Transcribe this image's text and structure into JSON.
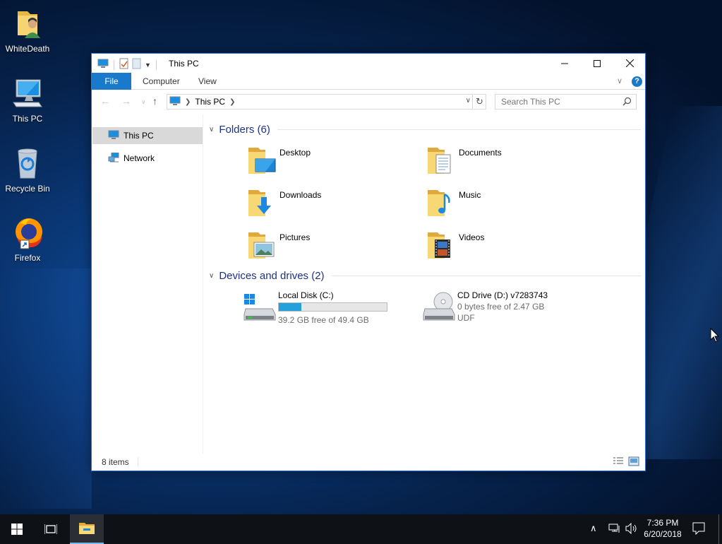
{
  "desktop": {
    "icons": [
      {
        "label": "WhiteDeath",
        "icon": "user-folder-icon"
      },
      {
        "label": "This PC",
        "icon": "computer-icon"
      },
      {
        "label": "Recycle Bin",
        "icon": "recycle-bin-icon"
      },
      {
        "label": "Firefox",
        "icon": "firefox-icon"
      }
    ]
  },
  "window": {
    "title": "This PC",
    "ribbon": {
      "tabs": [
        "File",
        "Computer",
        "View"
      ],
      "help": "?"
    },
    "address": {
      "crumb": "This PC"
    },
    "search": {
      "placeholder": "Search This PC"
    },
    "nav_pane": [
      {
        "label": "This PC",
        "selected": true,
        "icon": "computer-icon"
      },
      {
        "label": "Network",
        "selected": false,
        "icon": "network-icon"
      }
    ],
    "folders_group": {
      "header": "Folders (6)",
      "items": [
        {
          "name": "Desktop",
          "icon": "desktop-folder-icon"
        },
        {
          "name": "Documents",
          "icon": "documents-folder-icon"
        },
        {
          "name": "Downloads",
          "icon": "downloads-folder-icon"
        },
        {
          "name": "Music",
          "icon": "music-folder-icon"
        },
        {
          "name": "Pictures",
          "icon": "pictures-folder-icon"
        },
        {
          "name": "Videos",
          "icon": "videos-folder-icon"
        }
      ]
    },
    "drives_group": {
      "header": "Devices and drives (2)",
      "items": [
        {
          "name": "Local Disk (C:)",
          "free": "39.2 GB free of 49.4 GB",
          "used_fraction": 0.206,
          "icon": "local-disk-icon"
        },
        {
          "name": "CD Drive (D:) v7283743",
          "free": "0 bytes free of 2.47 GB",
          "fs": "UDF",
          "icon": "cd-drive-icon"
        }
      ]
    },
    "status": {
      "count": "8 items"
    }
  },
  "taskbar": {
    "clock_time": "7:36 PM",
    "clock_date": "6/20/2018"
  },
  "colors": {
    "accent": "#1979ca",
    "group_header": "#1e3287",
    "progress": "#26a0da",
    "taskbar": "#0e1115"
  }
}
